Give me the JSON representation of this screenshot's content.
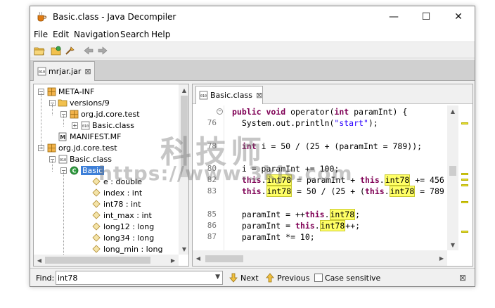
{
  "window": {
    "title": "Basic.class - Java Decompiler",
    "controls": {
      "minimize": "—",
      "maximize": "☐",
      "close": "✕"
    }
  },
  "menubar": [
    "File",
    "Edit",
    "Navigation",
    "Search",
    "Help"
  ],
  "toolbar": {
    "icons": [
      "open-file-icon",
      "open-type-icon",
      "search-icon",
      "back-icon",
      "forward-icon"
    ]
  },
  "file_tab": {
    "label": "mrjar.jar",
    "close": "⊠"
  },
  "tree": {
    "nodes": [
      {
        "label": "META-INF",
        "toggle": "−",
        "icon": "package-icon"
      },
      {
        "label": "versions/9",
        "toggle": "−",
        "icon": "folder-icon"
      },
      {
        "label": "org.jd.core.test",
        "toggle": "−",
        "icon": "package-icon"
      },
      {
        "label": "Basic.class",
        "toggle": "+",
        "icon": "class-file-icon"
      },
      {
        "label": "MANIFEST.MF",
        "toggle": "",
        "icon": "manifest-icon"
      },
      {
        "label": "org.jd.core.test",
        "toggle": "−",
        "icon": "package-icon"
      },
      {
        "label": "Basic.class",
        "toggle": "−",
        "icon": "class-file-icon"
      },
      {
        "label": "Basic",
        "toggle": "−",
        "icon": "class-icon",
        "selected": true
      },
      {
        "label": "e : double",
        "toggle": "",
        "icon": "field-icon"
      },
      {
        "label": "index : int",
        "toggle": "",
        "icon": "field-icon"
      },
      {
        "label": "int78 : int",
        "toggle": "",
        "icon": "field-icon"
      },
      {
        "label": "int_max : int",
        "toggle": "",
        "icon": "field-icon"
      },
      {
        "label": "long12 : long",
        "toggle": "",
        "icon": "field-icon"
      },
      {
        "label": "long34 : long",
        "toggle": "",
        "icon": "field-icon"
      },
      {
        "label": "long_min : long",
        "toggle": "",
        "icon": "field-icon"
      }
    ]
  },
  "editor_tab": {
    "label": "Basic.class",
    "close": "⊠"
  },
  "code": {
    "lines": [
      {
        "num": "",
        "parts": [
          [
            "kw",
            "public void "
          ],
          [
            "",
            "operator("
          ],
          [
            "kw",
            "int"
          ],
          [
            "",
            " paramInt) {"
          ]
        ]
      },
      {
        "num": "76",
        "parts": [
          [
            "",
            "  System.out.println("
          ],
          [
            "str",
            "\"start\""
          ],
          [
            "",
            ");"
          ]
        ]
      },
      {
        "num": "",
        "parts": []
      },
      {
        "num": "78",
        "parts": [
          [
            "",
            "  "
          ],
          [
            "kw",
            "int"
          ],
          [
            "",
            " i = 50 / (25 + (paramInt = 789));"
          ]
        ]
      },
      {
        "num": "",
        "parts": []
      },
      {
        "num": "80",
        "parts": [
          [
            "",
            "  i = paramInt += 100;"
          ]
        ]
      },
      {
        "num": "82",
        "parts": [
          [
            "",
            "  "
          ],
          [
            "kw",
            "this"
          ],
          [
            "",
            "."
          ],
          [
            "hl",
            "int78"
          ],
          [
            "",
            " = paramInt + "
          ],
          [
            "kw",
            "this"
          ],
          [
            "",
            "."
          ],
          [
            "hl",
            "int78"
          ],
          [
            "",
            " += 456"
          ]
        ]
      },
      {
        "num": "83",
        "parts": [
          [
            "",
            "  "
          ],
          [
            "kw",
            "this"
          ],
          [
            "",
            "."
          ],
          [
            "hl",
            "int78"
          ],
          [
            "",
            " = 50 / (25 + ("
          ],
          [
            "kw",
            "this"
          ],
          [
            "",
            "."
          ],
          [
            "hl",
            "int78"
          ],
          [
            "",
            " = 789"
          ]
        ]
      },
      {
        "num": "",
        "parts": []
      },
      {
        "num": "85",
        "parts": [
          [
            "",
            "  paramInt = ++"
          ],
          [
            "kw",
            "this"
          ],
          [
            "",
            "."
          ],
          [
            "hl",
            "int78"
          ],
          [
            "",
            ";"
          ]
        ]
      },
      {
        "num": "86",
        "parts": [
          [
            "",
            "  paramInt = "
          ],
          [
            "kw",
            "this"
          ],
          [
            "",
            "."
          ],
          [
            "hl",
            "int78"
          ],
          [
            "",
            "++;"
          ]
        ]
      },
      {
        "num": "87",
        "parts": [
          [
            "",
            "  paramInt *= 10;"
          ]
        ]
      }
    ]
  },
  "findbar": {
    "label": "Find:",
    "value": "int78",
    "next": "Next",
    "previous": "Previous",
    "case_sensitive": "Case sensitive",
    "close": "⊠"
  },
  "watermark": {
    "text_cn": "科技师",
    "url": "https://www.3kjs.com"
  },
  "colors": {
    "accent": "#3d7fd8",
    "highlight": "#ffff66",
    "keyword": "#7f0055",
    "string": "#2a00ff"
  }
}
